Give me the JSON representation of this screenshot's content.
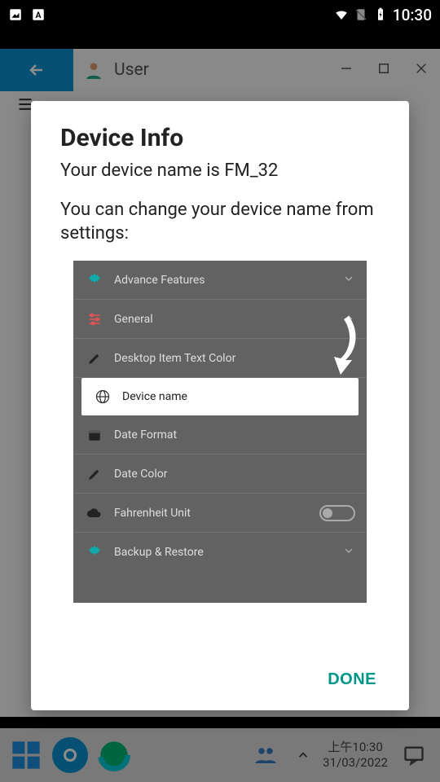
{
  "status": {
    "time": "10:30"
  },
  "titlebar": {
    "title": "User"
  },
  "taskbar": {
    "time": "上午10:30",
    "date": "31/03/2022"
  },
  "dialog": {
    "title": "Device Info",
    "subtitle": "Your device name is FM_32",
    "help": "You can change your device name from settings:",
    "done": "DONE"
  },
  "settingsShot": {
    "rows": {
      "advance": "Advance Features",
      "general": "General",
      "desktopColor": "Desktop Item Text Color",
      "deviceName": "Device name",
      "dateFormat": "Date Format",
      "dateColor": "Date Color",
      "fahrenheit": "Fahrenheit Unit",
      "backup": "Backup & Restore"
    }
  }
}
